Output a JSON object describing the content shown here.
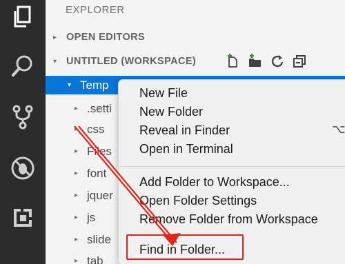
{
  "activity_bar": {
    "icons": [
      "explorer-icon",
      "search-icon",
      "source-control-icon",
      "debug-icon",
      "extensions-icon"
    ]
  },
  "sidebar": {
    "title": "EXPLORER",
    "open_editors": "OPEN EDITORS",
    "workspace": "UNTITLED (WORKSPACE)",
    "action_icons": [
      "new-file-icon",
      "new-folder-icon",
      "refresh-icon",
      "collapse-all-icon"
    ],
    "tree": [
      {
        "label": "Temp",
        "selected": true
      },
      {
        "label": ".setti"
      },
      {
        "label": "css"
      },
      {
        "label": "Files"
      },
      {
        "label": "font"
      },
      {
        "label": "jquer"
      },
      {
        "label": "js"
      },
      {
        "label": "slide"
      },
      {
        "label": "tab"
      }
    ]
  },
  "context_menu": {
    "items": [
      "New File",
      "New Folder",
      "Reveal in Finder",
      "Open in Terminal",
      "Add Folder to Workspace...",
      "Open Folder Settings",
      "Remove Folder from Workspace",
      "Find in Folder..."
    ],
    "shortcut_fragment": "⌥"
  },
  "colors": {
    "activity_bar": "#2c2c2c",
    "sidebar": "#f3f3f3",
    "selection": "#0a76d8",
    "annotation": "#e1251b"
  }
}
